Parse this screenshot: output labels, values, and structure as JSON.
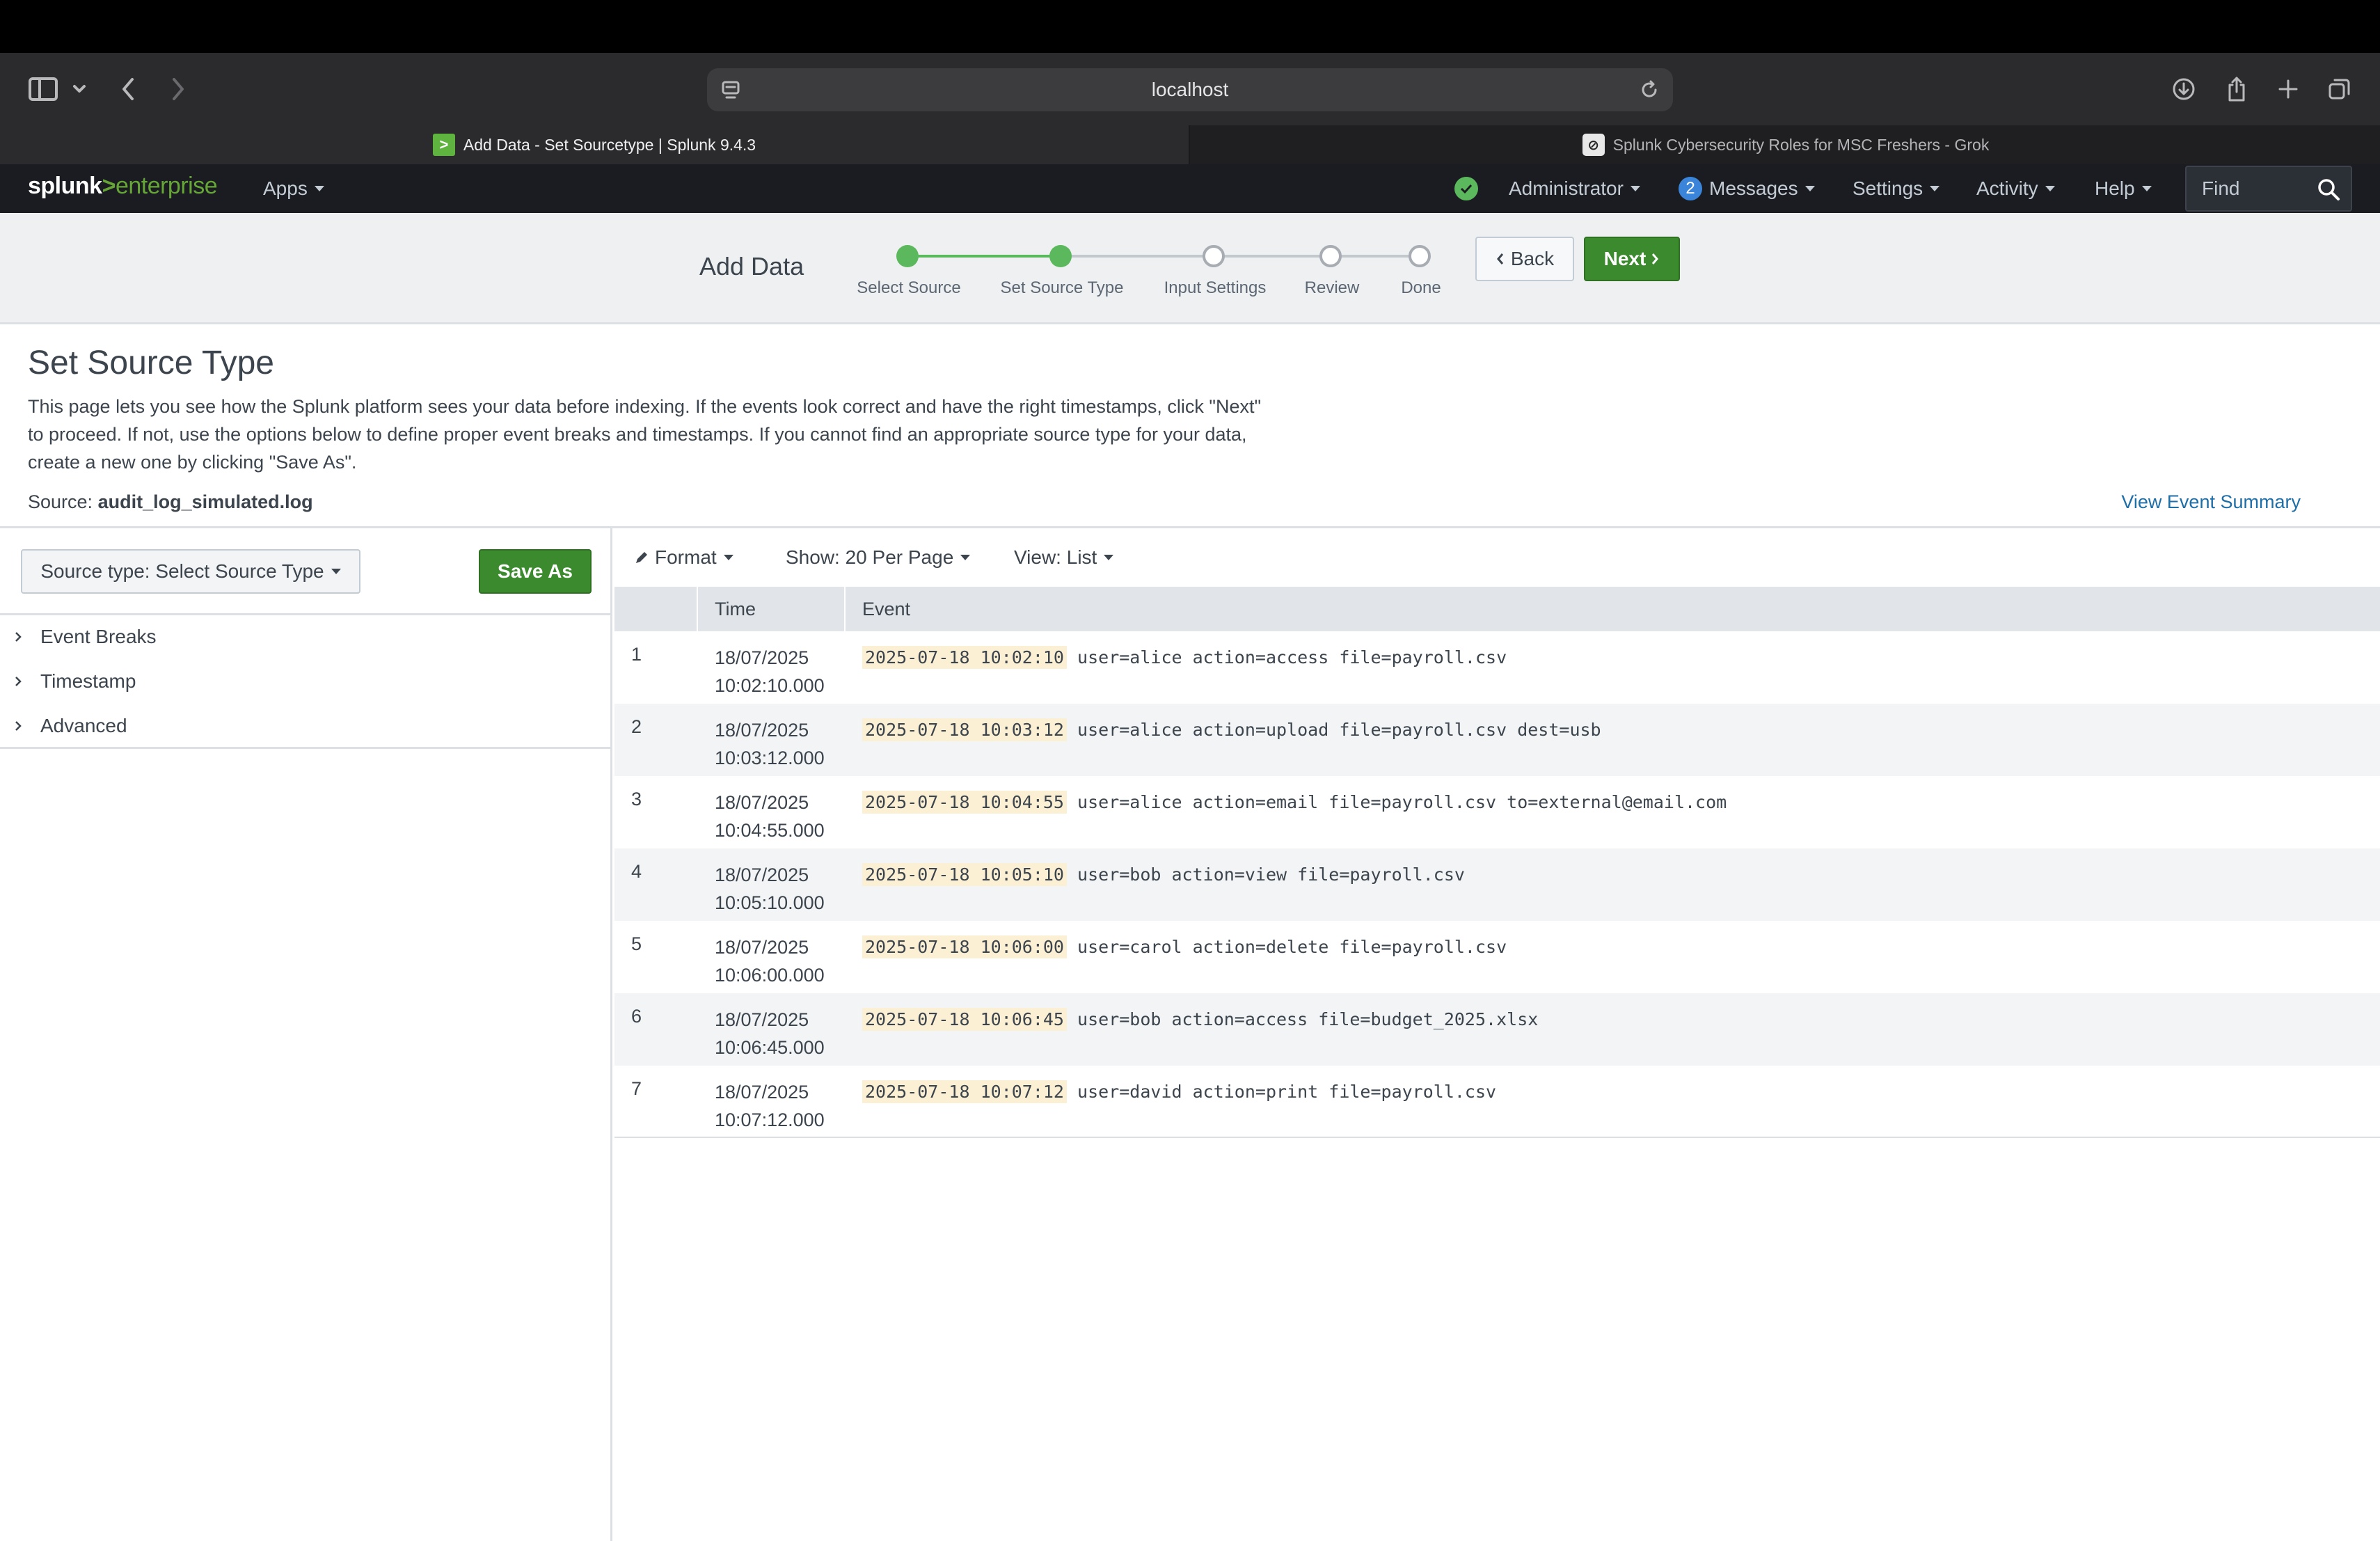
{
  "browser": {
    "url": "localhost",
    "tabs": [
      {
        "label": "Add Data - Set Sourcetype | Splunk 9.4.3",
        "active": true
      },
      {
        "label": "Splunk Cybersecurity Roles for MSC Freshers - Grok",
        "active": false
      }
    ]
  },
  "splunk_nav": {
    "logo_main": "splunk",
    "logo_gt": ">",
    "logo_product": "enterprise",
    "apps": "Apps",
    "user": "Administrator",
    "messages_count": "2",
    "messages": "Messages",
    "settings": "Settings",
    "activity": "Activity",
    "help": "Help",
    "find": "Find"
  },
  "wizard": {
    "title": "Add Data",
    "steps": [
      {
        "label": "Select Source",
        "state": "done"
      },
      {
        "label": "Set Source Type",
        "state": "current"
      },
      {
        "label": "Input Settings",
        "state": "todo"
      },
      {
        "label": "Review",
        "state": "todo"
      },
      {
        "label": "Done",
        "state": "todo"
      }
    ],
    "back_label": "Back",
    "next_label": "Next"
  },
  "page": {
    "title": "Set Source Type",
    "description": "This page lets you see how the Splunk platform sees your data before indexing. If the events look correct and have the right timestamps, click \"Next\" to proceed. If not, use the options below to define proper event breaks and timestamps. If you cannot find an appropriate source type for your data, create a new one by clicking \"Save As\".",
    "source_label": "Source:",
    "source_value": "audit_log_simulated.log",
    "view_summary": "View Event Summary"
  },
  "left_panel": {
    "source_type_button": "Source type: Select Source Type",
    "save_as": "Save As",
    "sections": [
      "Event Breaks",
      "Timestamp",
      "Advanced"
    ]
  },
  "right_panel": {
    "format": "Format",
    "show": "Show: 20 Per Page",
    "view": "View: List",
    "columns": {
      "time": "Time",
      "event": "Event"
    },
    "rows": [
      {
        "num": "1",
        "date": "18/07/2025",
        "clock": "10:02:10.000",
        "ts": "2025-07-18 10:02:10",
        "rest": " user=alice action=access file=payroll.csv"
      },
      {
        "num": "2",
        "date": "18/07/2025",
        "clock": "10:03:12.000",
        "ts": "2025-07-18 10:03:12",
        "rest": " user=alice action=upload file=payroll.csv dest=usb"
      },
      {
        "num": "3",
        "date": "18/07/2025",
        "clock": "10:04:55.000",
        "ts": "2025-07-18 10:04:55",
        "rest": " user=alice action=email file=payroll.csv to=external@email.com"
      },
      {
        "num": "4",
        "date": "18/07/2025",
        "clock": "10:05:10.000",
        "ts": "2025-07-18 10:05:10",
        "rest": " user=bob action=view file=payroll.csv"
      },
      {
        "num": "5",
        "date": "18/07/2025",
        "clock": "10:06:00.000",
        "ts": "2025-07-18 10:06:00",
        "rest": " user=carol action=delete file=payroll.csv"
      },
      {
        "num": "6",
        "date": "18/07/2025",
        "clock": "10:06:45.000",
        "ts": "2025-07-18 10:06:45",
        "rest": " user=bob action=access file=budget_2025.xlsx"
      },
      {
        "num": "7",
        "date": "18/07/2025",
        "clock": "10:07:12.000",
        "ts": "2025-07-18 10:07:12",
        "rest": " user=david action=print file=payroll.csv"
      }
    ]
  }
}
